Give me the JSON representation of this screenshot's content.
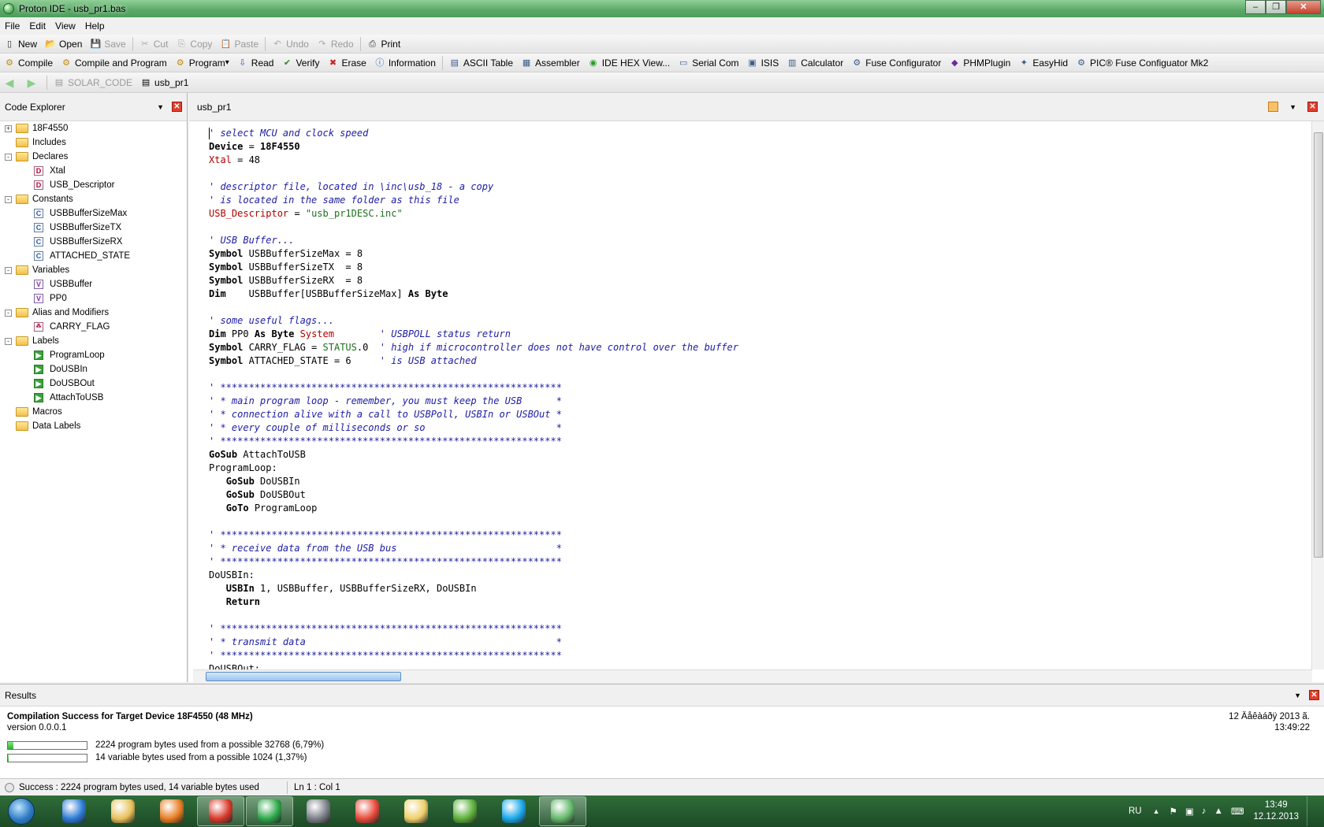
{
  "window": {
    "title": "Proton IDE - usb_pr1.bas"
  },
  "menu": [
    "File",
    "Edit",
    "View",
    "Help"
  ],
  "toolbar1": [
    {
      "label": "New",
      "icon": "new-icon",
      "enabled": true
    },
    {
      "label": "Open",
      "icon": "open-icon",
      "enabled": true
    },
    {
      "label": "Save",
      "icon": "save-icon",
      "enabled": false
    },
    {
      "label": "Cut",
      "icon": "cut-icon",
      "enabled": false
    },
    {
      "label": "Copy",
      "icon": "copy-icon",
      "enabled": false
    },
    {
      "label": "Paste",
      "icon": "paste-icon",
      "enabled": false
    },
    {
      "label": "Undo",
      "icon": "undo-icon",
      "enabled": false
    },
    {
      "label": "Redo",
      "icon": "redo-icon",
      "enabled": false
    },
    {
      "label": "Print",
      "icon": "print-icon",
      "enabled": true
    }
  ],
  "toolbar2": [
    {
      "label": "Compile",
      "icon": "compile-icon"
    },
    {
      "label": "Compile and Program",
      "icon": "compile-program-icon"
    },
    {
      "label": "Program",
      "icon": "program-icon"
    },
    {
      "label": "Read",
      "icon": "read-icon"
    },
    {
      "label": "Verify",
      "icon": "verify-icon"
    },
    {
      "label": "Erase",
      "icon": "erase-icon"
    },
    {
      "label": "Information",
      "icon": "information-icon"
    },
    {
      "label": "ASCII Table",
      "icon": "ascii-table-icon"
    },
    {
      "label": "Assembler",
      "icon": "assembler-icon"
    },
    {
      "label": "IDE HEX View...",
      "icon": "hex-view-icon"
    },
    {
      "label": "Serial Com",
      "icon": "serial-com-icon"
    },
    {
      "label": "ISIS",
      "icon": "isis-icon"
    },
    {
      "label": "Calculator",
      "icon": "calculator-icon"
    },
    {
      "label": "Fuse Configurator",
      "icon": "fuse-configurator-icon"
    },
    {
      "label": "PHMPlugin",
      "icon": "phmplugin-icon"
    },
    {
      "label": "EasyHid",
      "icon": "easyhid-icon"
    },
    {
      "label": "PIC® Fuse Configuator Mk2",
      "icon": "fuse-mk2-icon"
    }
  ],
  "toolbar3": {
    "tabs": [
      "SOLAR_CODE",
      "usb_pr1"
    ]
  },
  "explorer": {
    "title": "Code Explorer",
    "tree": [
      {
        "label": "18F4550",
        "type": "folder",
        "level": 0,
        "expander": "+"
      },
      {
        "label": "Includes",
        "type": "folder",
        "level": 0,
        "expander": ""
      },
      {
        "label": "Declares",
        "type": "folder",
        "level": 0,
        "expander": "-"
      },
      {
        "label": "Xtal",
        "type": "D",
        "level": 1
      },
      {
        "label": "USB_Descriptor",
        "type": "D",
        "level": 1
      },
      {
        "label": "Constants",
        "type": "folder",
        "level": 0,
        "expander": "-"
      },
      {
        "label": "USBBufferSizeMax",
        "type": "C",
        "level": 1
      },
      {
        "label": "USBBufferSizeTX",
        "type": "C",
        "level": 1
      },
      {
        "label": "USBBufferSizeRX",
        "type": "C",
        "level": 1
      },
      {
        "label": "ATTACHED_STATE",
        "type": "C",
        "level": 1
      },
      {
        "label": "Variables",
        "type": "folder",
        "level": 0,
        "expander": "-"
      },
      {
        "label": "USBBuffer",
        "type": "V",
        "level": 1
      },
      {
        "label": "PP0",
        "type": "V",
        "level": 1
      },
      {
        "label": "Alias and Modifiers",
        "type": "folder",
        "level": 0,
        "expander": "-"
      },
      {
        "label": "CARRY_FLAG",
        "type": "A",
        "level": 1
      },
      {
        "label": "Labels",
        "type": "folder",
        "level": 0,
        "expander": "-"
      },
      {
        "label": "ProgramLoop",
        "type": "L",
        "level": 1
      },
      {
        "label": "DoUSBIn",
        "type": "L",
        "level": 1
      },
      {
        "label": "DoUSBOut",
        "type": "L",
        "level": 1
      },
      {
        "label": "AttachToUSB",
        "type": "L",
        "level": 1
      },
      {
        "label": "Macros",
        "type": "folder",
        "level": 0,
        "expander": ""
      },
      {
        "label": "Data Labels",
        "type": "folder",
        "level": 0,
        "expander": ""
      }
    ]
  },
  "editor": {
    "tab": "usb_pr1",
    "lines": [
      [
        [
          "cm",
          "' select MCU and clock speed"
        ]
      ],
      [
        [
          "kw",
          "Device"
        ],
        [
          "nm",
          " = "
        ],
        [
          "kw",
          "18F4550"
        ]
      ],
      [
        [
          "kr",
          "Xtal"
        ],
        [
          "nm",
          " = 48"
        ]
      ],
      [],
      [
        [
          "cm",
          "' descriptor file, located in \\inc\\usb_18 - a copy"
        ]
      ],
      [
        [
          "cm",
          "' is located in the same folder as this file"
        ]
      ],
      [
        [
          "kr",
          "USB_Descriptor"
        ],
        [
          "nm",
          " = "
        ],
        [
          "str",
          "\"usb_pr1DESC.inc\""
        ]
      ],
      [],
      [
        [
          "cm",
          "' USB Buffer..."
        ]
      ],
      [
        [
          "kw",
          "Symbol"
        ],
        [
          "nm",
          " USBBufferSizeMax = 8"
        ]
      ],
      [
        [
          "kw",
          "Symbol"
        ],
        [
          "nm",
          " USBBufferSizeTX  = 8"
        ]
      ],
      [
        [
          "kw",
          "Symbol"
        ],
        [
          "nm",
          " USBBufferSizeRX  = 8"
        ]
      ],
      [
        [
          "kw",
          "Dim"
        ],
        [
          "nm",
          "    USBBuffer[USBBufferSizeMax] "
        ],
        [
          "kw",
          "As Byte"
        ]
      ],
      [],
      [
        [
          "cm",
          "' some useful flags..."
        ]
      ],
      [
        [
          "kw",
          "Dim"
        ],
        [
          "nm",
          " PP0 "
        ],
        [
          "kw",
          "As Byte"
        ],
        [
          "nm",
          " "
        ],
        [
          "kr",
          "System"
        ],
        [
          "nm",
          "        "
        ],
        [
          "cm",
          "' USBPOLL status return"
        ]
      ],
      [
        [
          "kw",
          "Symbol"
        ],
        [
          "nm",
          " CARRY_FLAG = "
        ],
        [
          "str",
          "STATUS"
        ],
        [
          "nm",
          ".0  "
        ],
        [
          "cm",
          "' high if microcontroller does not have control over the buffer"
        ]
      ],
      [
        [
          "kw",
          "Symbol"
        ],
        [
          "nm",
          " ATTACHED_STATE = 6     "
        ],
        [
          "cm",
          "' is USB attached"
        ]
      ],
      [],
      [
        [
          "cm",
          "' ************************************************************"
        ]
      ],
      [
        [
          "cm",
          "' * main program loop - remember, you must keep the USB      *"
        ]
      ],
      [
        [
          "cm",
          "' * connection alive with a call to USBPoll, USBIn or USBOut *"
        ]
      ],
      [
        [
          "cm",
          "' * every couple of milliseconds or so                       *"
        ]
      ],
      [
        [
          "cm",
          "' ************************************************************"
        ]
      ],
      [
        [
          "kw",
          "GoSub"
        ],
        [
          "nm",
          " AttachToUSB"
        ]
      ],
      [
        [
          "nm",
          "ProgramLoop:"
        ]
      ],
      [
        [
          "nm",
          "   "
        ],
        [
          "kw",
          "GoSub"
        ],
        [
          "nm",
          " DoUSBIn"
        ]
      ],
      [
        [
          "nm",
          "   "
        ],
        [
          "kw",
          "GoSub"
        ],
        [
          "nm",
          " DoUSBOut"
        ]
      ],
      [
        [
          "nm",
          "   "
        ],
        [
          "kw",
          "GoTo"
        ],
        [
          "nm",
          " ProgramLoop"
        ]
      ],
      [],
      [
        [
          "cm",
          "' ************************************************************"
        ]
      ],
      [
        [
          "cm",
          "' * receive data from the USB bus                            *"
        ]
      ],
      [
        [
          "cm",
          "' ************************************************************"
        ]
      ],
      [
        [
          "nm",
          "DoUSBIn:"
        ]
      ],
      [
        [
          "nm",
          "   "
        ],
        [
          "kw",
          "USBIn"
        ],
        [
          "nm",
          " 1, USBBuffer, USBBufferSizeRX, DoUSBIn"
        ]
      ],
      [
        [
          "nm",
          "   "
        ],
        [
          "kw",
          "Return"
        ]
      ],
      [],
      [
        [
          "cm",
          "' ************************************************************"
        ]
      ],
      [
        [
          "cm",
          "' * transmit data                                            *"
        ]
      ],
      [
        [
          "cm",
          "' ************************************************************"
        ]
      ],
      [
        [
          "nm",
          "DoUSBOut:"
        ]
      ]
    ]
  },
  "results": {
    "title": "Results",
    "headline": "Compilation Success for Target Device 18F4550 (48 MHz)",
    "version": "version 0.0.0.1",
    "date": "12 Äåêàáðÿ 2013 ã.",
    "time": "13:49:22",
    "program_usage": {
      "text": "2224 program bytes used from a possible 32768 (6,79%)",
      "fraction": 0.0679
    },
    "variable_usage": {
      "text": "14 variable bytes used from a possible 1024 (1,37%)",
      "fraction": 0.0137
    }
  },
  "status": {
    "message": "Success : 2224 program bytes used, 14 variable bytes used",
    "position": "Ln 1 : Col 1"
  },
  "taskbar": {
    "lang": "RU",
    "time": "13:49",
    "date": "12.12.2013",
    "apps": [
      {
        "icon": "ie-icon",
        "color": "#2b7bd6"
      },
      {
        "icon": "explorer-icon",
        "color": "#e8c15a"
      },
      {
        "icon": "media-player-icon",
        "color": "#e67d22"
      },
      {
        "icon": "chrome-icon",
        "color": "#d93a2b"
      },
      {
        "icon": "mail-agent-icon",
        "color": "#2ea84a"
      },
      {
        "icon": "tool-icon",
        "color": "#7c8088"
      },
      {
        "icon": "app-grid-icon",
        "color": "#e84a3a"
      },
      {
        "icon": "folder-icon",
        "color": "#efcf6a"
      },
      {
        "icon": "utorrent-icon",
        "color": "#5cb03a"
      },
      {
        "icon": "skype-icon",
        "color": "#18a7e8"
      },
      {
        "icon": "proton-ide-icon",
        "color": "#63b86a"
      }
    ]
  },
  "colors": {
    "accent": "#4f9c5c",
    "comment": "#1c1ca3",
    "keyword_red": "#b30000",
    "string": "#1d6f1d"
  }
}
